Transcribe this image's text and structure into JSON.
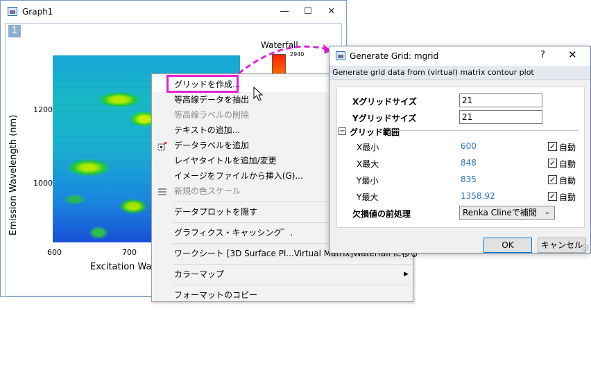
{
  "graph_window": {
    "title": "Graph1",
    "layer_number": "1",
    "minimize_glyph": "—",
    "maximize_glyph": "☐",
    "close_glyph": "✕",
    "y_axis_label": "Emission Wavelength (nm)",
    "x_axis_label": "Excitation Wav",
    "y_ticks": [
      "1200",
      "1000"
    ],
    "x_ticks": [
      "600",
      "700"
    ],
    "waterfall_title": "Waterfall",
    "colorbar_label": "2940"
  },
  "context_menu": {
    "items": [
      {
        "label": "グリッドを作成...",
        "state": "highlighted"
      },
      {
        "label": "等高線データを抽出",
        "state": "enabled"
      },
      {
        "label": "等高線ラベルの削除",
        "state": "disabled"
      },
      {
        "label": "テキストの追加...",
        "state": "enabled"
      },
      {
        "label": "データラベルを追加",
        "state": "enabled"
      },
      {
        "label": "レイヤタイトルを追加/変更",
        "state": "enabled"
      },
      {
        "label": "イメージをファイルから挿入(G)...",
        "state": "enabled"
      },
      {
        "label": "新規の色スケール",
        "state": "disabled"
      },
      {
        "label": "データプロットを隠す",
        "state": "enabled"
      },
      {
        "label": "グラフィクス・キャッシング゛.",
        "state": "enabled"
      },
      {
        "label": "ワークシート [3D Surface Pl...Virtual Matrix]Waterfall に移る",
        "state": "enabled"
      },
      {
        "label": "カラーマップ",
        "state": "enabled"
      },
      {
        "label": "フォーマットのコピー",
        "state": "enabled"
      }
    ],
    "submenu_arrow": "▶"
  },
  "dialog": {
    "title": "Generate Grid: mgrid",
    "help_glyph": "?",
    "close_glyph": "✕",
    "description": "Generate grid data from (virtual) matrix contour plot",
    "x_grid_size_label": "Xグリッドサイズ",
    "x_grid_size_value": "21",
    "y_grid_size_label": "Yグリッドサイズ",
    "y_grid_size_value": "21",
    "grid_range_label": "グリッド範囲",
    "collapse_glyph": "−",
    "range_rows": [
      {
        "label": "X最小",
        "value": "600",
        "auto_label": "自動",
        "checked": true
      },
      {
        "label": "X最大",
        "value": "848",
        "auto_label": "自動",
        "checked": true
      },
      {
        "label": "Y最小",
        "value": "835",
        "auto_label": "自動",
        "checked": true
      },
      {
        "label": "Y最大",
        "value": "1358.92",
        "auto_label": "自動",
        "checked": true
      }
    ],
    "check_glyph": "✓",
    "missing_label": "欠損値の前処理",
    "missing_value": "Renka Clineで補間",
    "select_caret": "⌄",
    "ok_label": "OK",
    "cancel_label": "キャンセル"
  },
  "colors": {
    "highlight_box": "#e41fd5",
    "annotation_arrow": "#e41fd5",
    "value_text": "#2f74c4"
  }
}
